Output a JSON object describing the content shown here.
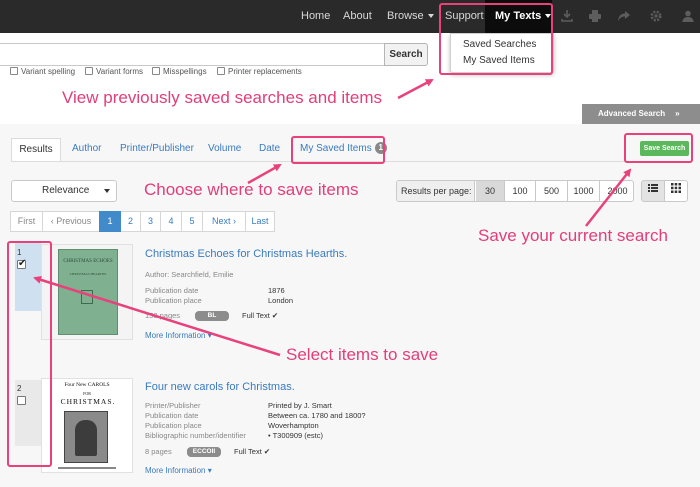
{
  "nav": {
    "links": [
      "Home",
      "About",
      "Browse",
      "Support",
      "My Texts"
    ],
    "icons": [
      "download-icon",
      "print-icon",
      "share-icon",
      "gear-icon",
      "user-icon"
    ],
    "mytexts_menu": [
      "Saved Searches",
      "My Saved Items"
    ]
  },
  "search": {
    "button_label": "Search",
    "query": "",
    "options": [
      "Variant spelling",
      "Variant forms",
      "Misspellings",
      "Printer replacements"
    ],
    "advanced_label": "Advanced Search"
  },
  "tabs": {
    "items": [
      "Results",
      "Author",
      "Printer/Publisher",
      "Volume",
      "Date",
      "My Saved Items"
    ],
    "saved_count": "1",
    "save_search_label": "Save Search"
  },
  "sort": {
    "selected": "Relevance",
    "per_page_label": "Results per page:",
    "per_page_options": [
      "30",
      "100",
      "500",
      "1000",
      "2000"
    ],
    "per_page_selected": "30"
  },
  "pagination": {
    "items": [
      "First",
      "‹ Previous",
      "1",
      "2",
      "3",
      "4",
      "5",
      "Next ›",
      "Last"
    ],
    "current": "1"
  },
  "results": [
    {
      "number": "1",
      "checked": true,
      "title": "Christmas Echoes for Christmas Hearths.",
      "author": "Author: Searchfield, Emilie",
      "fields": [
        {
          "label": "Publication date",
          "value": "1876"
        },
        {
          "label": "Publication place",
          "value": "London"
        }
      ],
      "pages": "158 pages",
      "source": "BL",
      "fulltext": "Full Text ✔",
      "more_info": "More Information ▾",
      "thumb_title": "CHRISTMAS ECHOES",
      "thumb_subtitle": "CHRISTMAS HEARTHS"
    },
    {
      "number": "2",
      "checked": false,
      "title": "Four new carols for Christmas.",
      "fields": [
        {
          "label": "Printer/Publisher",
          "value": "Printed by J. Smart"
        },
        {
          "label": "Publication date",
          "value": "Between ca. 1780 and 1800?"
        },
        {
          "label": "Publication place",
          "value": "Woverhampton"
        },
        {
          "label": "Bibliographic number/identifier",
          "value": "• T300909  (estc)"
        }
      ],
      "pages": "8 pages",
      "source": "ECCOII",
      "fulltext": "Full Text ✔",
      "more_info": "More Information ▾",
      "thumb_line1": "Four New CAROLS",
      "thumb_line2": "FOR",
      "thumb_line3": "CHRISTMAS."
    }
  ],
  "annotations": {
    "saved_menu": "View previously saved searches and items",
    "choose_where": "Choose where to save items",
    "save_current": "Save your current search",
    "select_items": "Select items to save",
    "color": "#e8417c"
  }
}
